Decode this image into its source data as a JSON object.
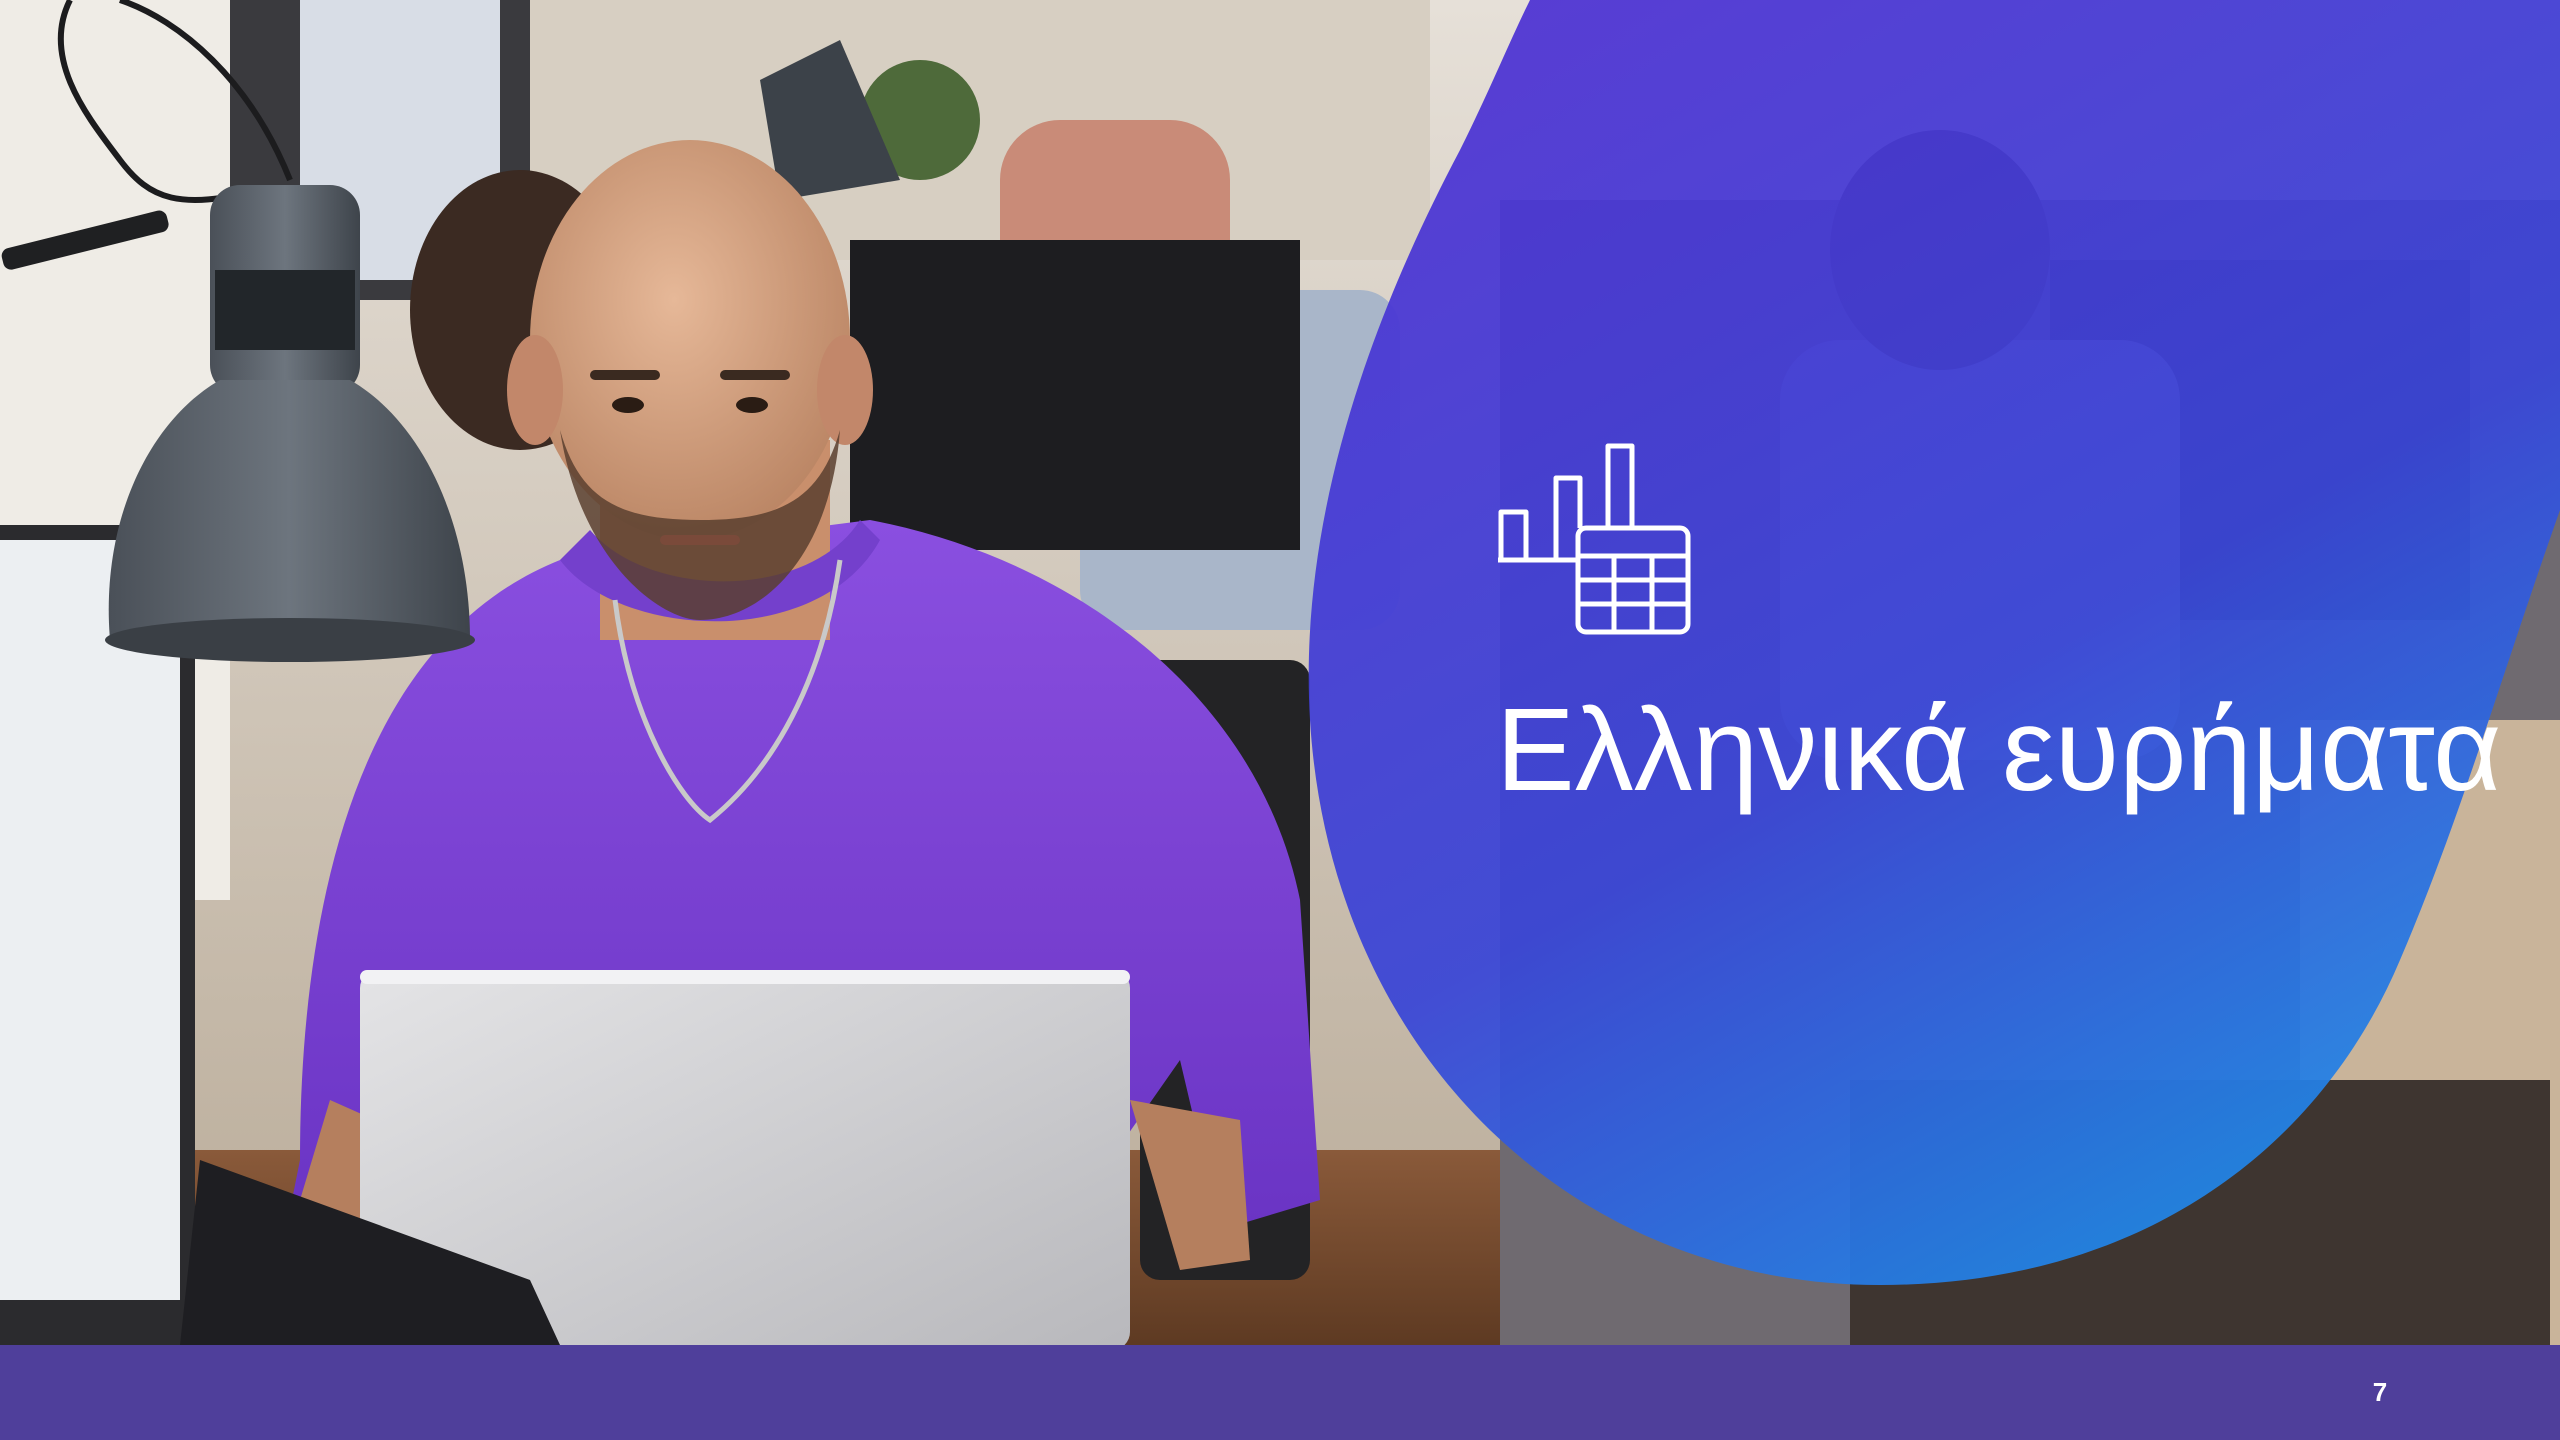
{
  "slide": {
    "title": "Ελληνικά ευρήματα",
    "page_number": "7",
    "icon": "bar-chart-table-icon",
    "colors": {
      "footer": "#4f3f9b",
      "blob_top": "#4b2fd0",
      "blob_bottom": "#1f8fe6",
      "title_text": "#ffffff"
    }
  },
  "photo": {
    "description_icon": "person-at-laptop-photo"
  }
}
